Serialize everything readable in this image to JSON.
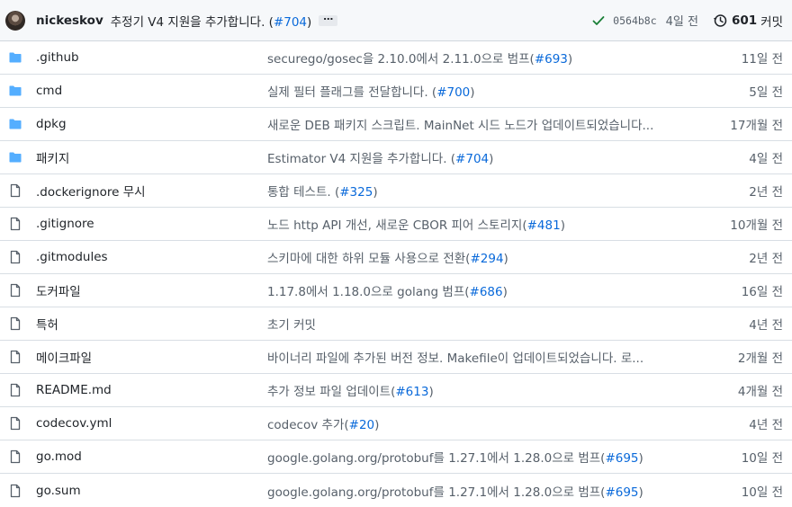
{
  "commit": {
    "author": "nickeskov",
    "message": "추정기 V4 지원을 추가합니다. (",
    "pr": "#704",
    "message_end": ")",
    "ellipsis": "…",
    "sha": "0564b8c",
    "time": "4일 전",
    "count": "601",
    "count_label": "커밋"
  },
  "colors": {
    "link": "#0969da",
    "folder": "#54aeff",
    "check": "#1a7f37"
  },
  "files": [
    {
      "type": "folder",
      "name": ".github",
      "msg": "securego/gosec을 2.10.0에서 2.11.0으로 범프(",
      "pr": "#693",
      "end": ")",
      "time": "11일 전"
    },
    {
      "type": "folder",
      "name": "cmd",
      "msg": "실제 필터 플래그를 전달합니다. (",
      "pr": "#700",
      "end": ")",
      "time": "5일 전"
    },
    {
      "type": "folder",
      "name": "dpkg",
      "msg": "새로운 DEB 패키지 스크립트. MainNet 시드 노드가 업데이트되었습니다...",
      "pr": "",
      "end": "",
      "time": "17개월 전"
    },
    {
      "type": "folder",
      "name": "패키지",
      "msg": "Estimator V4 지원을 추가합니다. (",
      "pr": "#704",
      "end": ")",
      "time": "4일 전"
    },
    {
      "type": "file",
      "name": ".dockerignore 무시",
      "msg": "통합 테스트. (",
      "pr": "#325",
      "end": ")",
      "time": "2년 전"
    },
    {
      "type": "file",
      "name": ".gitignore",
      "msg": "노드 http API 개선, 새로운 CBOR 피어 스토리지(",
      "pr": "#481",
      "end": ")",
      "time": "10개월 전"
    },
    {
      "type": "file",
      "name": ".gitmodules",
      "msg": "스키마에 대한 하위 모듈 사용으로 전환(",
      "pr": "#294",
      "end": ")",
      "time": "2년 전"
    },
    {
      "type": "file",
      "name": "도커파일",
      "msg": "1.17.8에서 1.18.0으로 golang 범프(",
      "pr": "#686",
      "end": ")",
      "time": "16일 전"
    },
    {
      "type": "file",
      "name": "특허",
      "msg": "초기 커밋",
      "pr": "",
      "end": "",
      "time": "4년 전"
    },
    {
      "type": "file",
      "name": "메이크파일",
      "msg": "바이너리 파일에 추가된 버전 정보. Makefile이 업데이트되었습니다. 로...",
      "pr": "",
      "end": "",
      "time": "2개월 전"
    },
    {
      "type": "file",
      "name": "README.md",
      "msg": "추가 정보 파일 업데이트(",
      "pr": "#613",
      "end": ")",
      "time": "4개월 전"
    },
    {
      "type": "file",
      "name": "codecov.yml",
      "msg": "codecov 추가(",
      "pr": "#20",
      "end": ")",
      "time": "4년 전"
    },
    {
      "type": "file",
      "name": "go.mod",
      "msg": "google.golang.org/protobuf를 1.27.1에서 1.28.0으로 범프(",
      "pr": "#695",
      "end": ")",
      "time": "10일 전"
    },
    {
      "type": "file",
      "name": "go.sum",
      "msg": "google.golang.org/protobuf를 1.27.1에서 1.28.0으로 범프(",
      "pr": "#695",
      "end": ")",
      "time": "10일 전"
    }
  ]
}
